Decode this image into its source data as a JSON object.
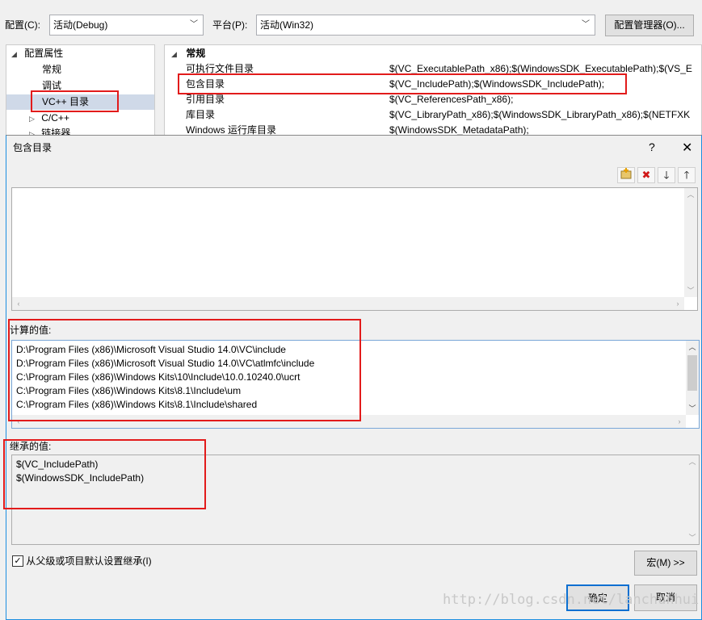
{
  "top": {
    "config_label": "配置(C):",
    "config_value": "活动(Debug)",
    "platform_label": "平台(P):",
    "platform_value": "活动(Win32)",
    "config_manager_button": "配置管理器(O)..."
  },
  "tree": {
    "root": "配置属性",
    "items": [
      "常规",
      "调试",
      "VC++ 目录",
      "C/C++",
      "链接器"
    ]
  },
  "grid": {
    "section": "常规",
    "rows": [
      {
        "name": "可执行文件目录",
        "value": "$(VC_ExecutablePath_x86);$(WindowsSDK_ExecutablePath);$(VS_E"
      },
      {
        "name": "包含目录",
        "value": "$(VC_IncludePath);$(WindowsSDK_IncludePath);"
      },
      {
        "name": "引用目录",
        "value": "$(VC_ReferencesPath_x86);"
      },
      {
        "name": "库目录",
        "value": "$(VC_LibraryPath_x86);$(WindowsSDK_LibraryPath_x86);$(NETFXK"
      },
      {
        "name": "Windows 运行库目录",
        "value": "$(WindowsSDK_MetadataPath);"
      }
    ]
  },
  "dialog": {
    "title": "包含目录",
    "help_glyph": "?",
    "close_glyph": "✕",
    "computed_label": "计算的值:",
    "computed_values": [
      "D:\\Program Files (x86)\\Microsoft Visual Studio 14.0\\VC\\include",
      "D:\\Program Files (x86)\\Microsoft Visual Studio 14.0\\VC\\atlmfc\\include",
      "C:\\Program Files (x86)\\Windows Kits\\10\\Include\\10.0.10240.0\\ucrt",
      "C:\\Program Files (x86)\\Windows Kits\\8.1\\Include\\um",
      "C:\\Program Files (x86)\\Windows Kits\\8.1\\Include\\shared"
    ],
    "inherited_label": "继承的值:",
    "inherited_values": [
      "$(VC_IncludePath)",
      "$(WindowsSDK_IncludePath)"
    ],
    "inherit_checkbox_label": "从父级或项目默认设置继承(I)",
    "inherit_checked": true,
    "macro_button": "宏(M) >>",
    "ok_button": "确定",
    "cancel_button": "取消"
  },
  "watermark": "http://blog.csdn.net/lanchunhui",
  "colors": {
    "highlight_border": "#e21b1b",
    "selected_tree_bg": "#cfd9e8",
    "dialog_border": "#1c8ee0"
  }
}
